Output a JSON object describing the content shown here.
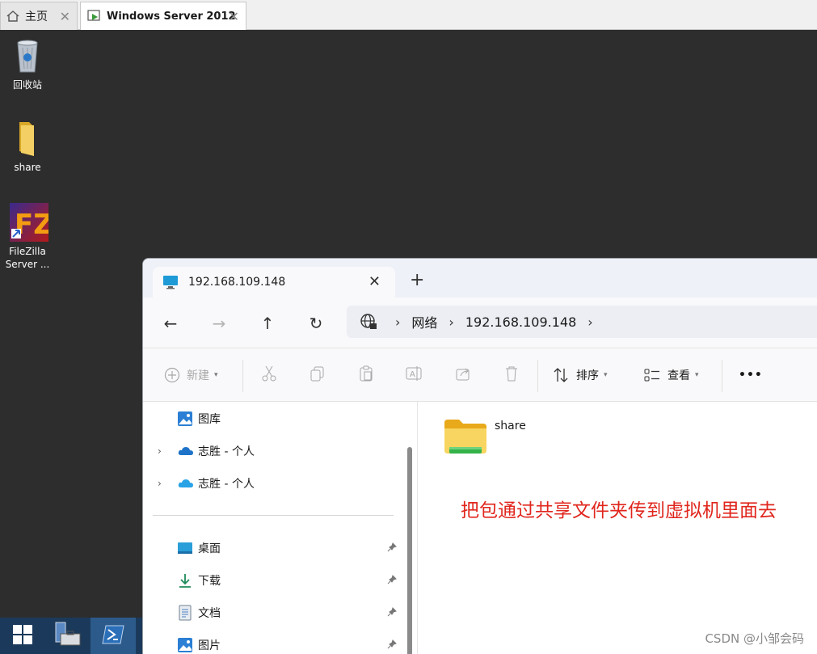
{
  "vmware": {
    "tabs": [
      {
        "label": "主页",
        "icon": "home-icon"
      },
      {
        "label": "Windows Server 2012",
        "icon": "vm-running-icon",
        "active": true
      }
    ],
    "close_glyph": "✕"
  },
  "desktop": {
    "icons": [
      {
        "label": "回收站",
        "icon": "recycle-bin-icon"
      },
      {
        "label": "share",
        "icon": "folder-icon"
      },
      {
        "label_line1": "FileZilla",
        "label_line2": "Server ...",
        "icon": "filezilla-icon"
      }
    ]
  },
  "explorer": {
    "tab_title": "192.168.109.148",
    "new_tab_glyph": "+",
    "nav": {
      "back": "←",
      "forward": "→",
      "up": "↑",
      "refresh": "↻"
    },
    "address": {
      "segments": [
        "网络",
        "192.168.109.148"
      ],
      "sep": "›"
    },
    "toolbar": {
      "new_label": "新建",
      "sort_label": "排序",
      "view_label": "查看",
      "more_glyph": "•••"
    },
    "nav_pane": {
      "items": [
        {
          "label": "图库",
          "icon": "gallery-icon"
        },
        {
          "label": "志胜 - 个人",
          "icon": "onedrive-icon",
          "expandable": true
        },
        {
          "label": "志胜 - 个人",
          "icon": "onedrive-icon",
          "expandable": true
        },
        {
          "label": "桌面",
          "icon": "desktop-icon",
          "pinned": true
        },
        {
          "label": "下载",
          "icon": "download-icon",
          "pinned": true
        },
        {
          "label": "文档",
          "icon": "document-icon",
          "pinned": true
        },
        {
          "label": "图片",
          "icon": "pictures-icon",
          "pinned": true
        }
      ]
    },
    "content": {
      "items": [
        {
          "label": "share",
          "icon": "shared-folder-icon"
        }
      ],
      "annotation": "把包通过共享文件夹传到虚拟机里面去"
    }
  },
  "watermark": "CSDN @小邹会码",
  "colors": {
    "annotation": "#e0261d",
    "taskbar": "#1b3a5b",
    "desktop": "#2d2d2d"
  }
}
